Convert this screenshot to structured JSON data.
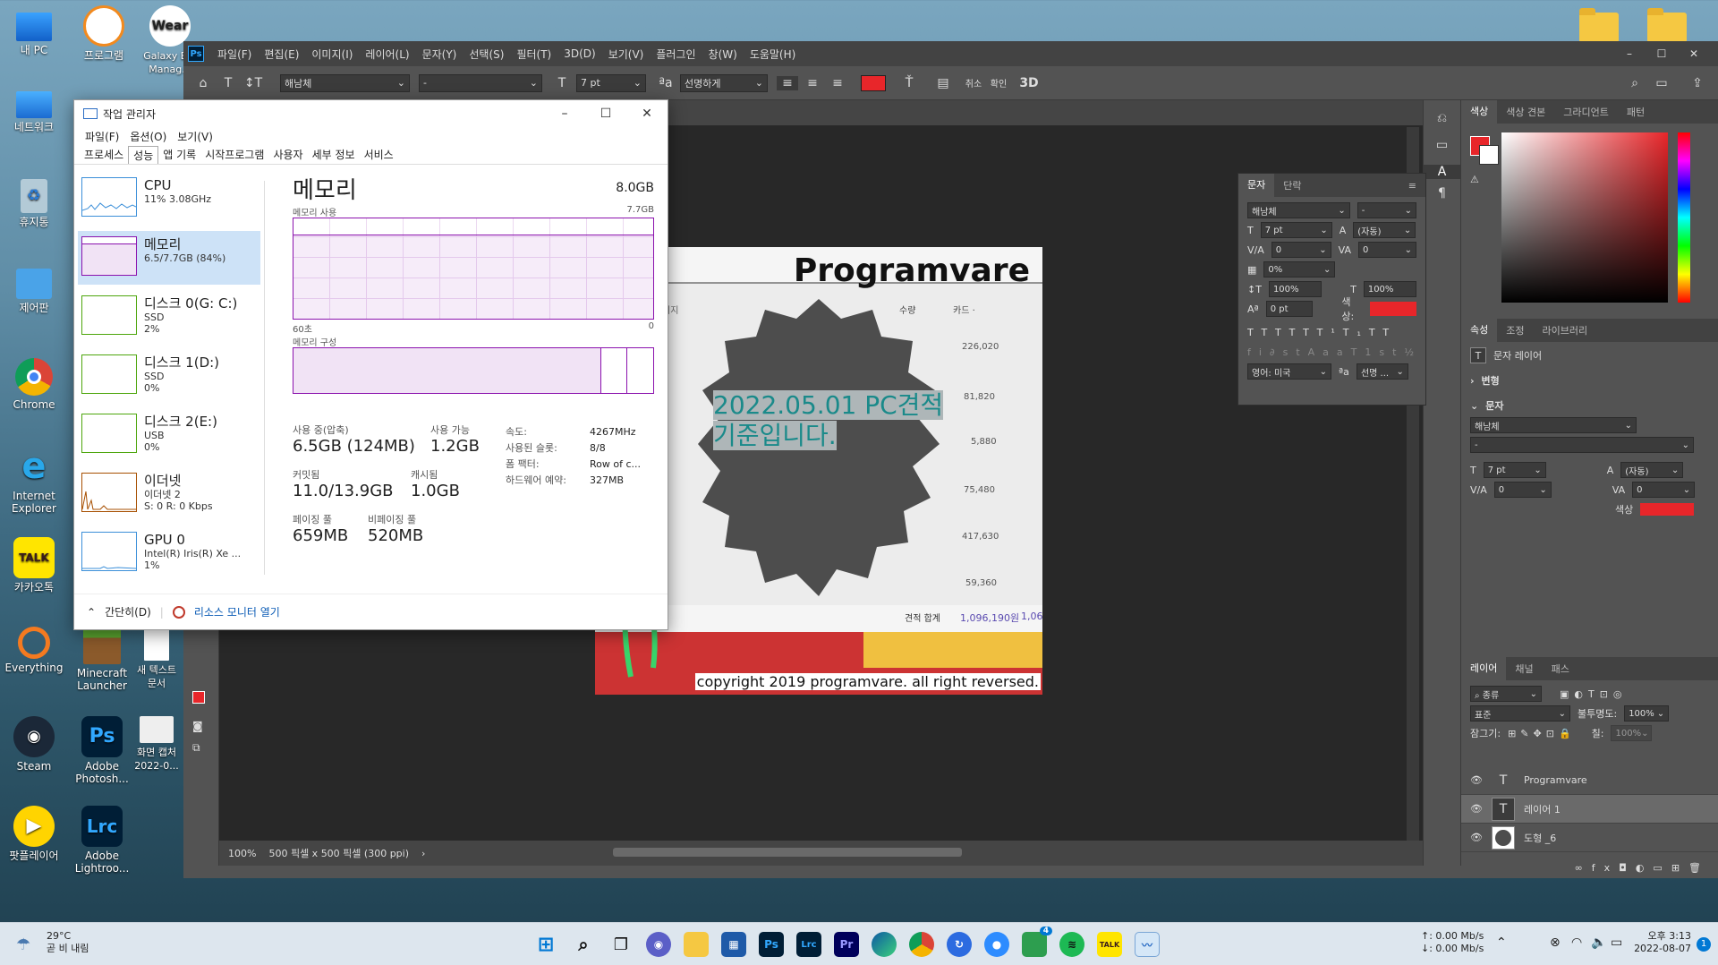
{
  "desktop": {
    "icons": [
      {
        "label": "내 PC",
        "icon": "monitor-icon"
      },
      {
        "label": "프로그램",
        "icon": "app-icon"
      },
      {
        "label": "Wear",
        "icon": "wear-icon"
      },
      {
        "label": "Galaxy B... Manag...",
        "icon": "galaxy-icon"
      },
      {
        "label": "네트워크",
        "icon": "network-icon"
      },
      {
        "label": "휴지통",
        "icon": "recycle-bin-icon"
      },
      {
        "label": "제어판",
        "icon": "control-panel-icon"
      },
      {
        "label": "Chrome",
        "icon": "chrome-icon"
      },
      {
        "label": "Internet Explorer",
        "icon": "ie-icon"
      },
      {
        "label": "카카오톡",
        "icon": "kakaotalk-icon"
      },
      {
        "label": "Everything",
        "icon": "everything-icon"
      },
      {
        "label": "Minecraft Launcher",
        "icon": "minecraft-icon"
      },
      {
        "label": "새 텍스트 문서",
        "icon": "text-doc-icon"
      },
      {
        "label": "Steam",
        "icon": "steam-icon"
      },
      {
        "label": "Adobe Photosh...",
        "icon": "photoshop-icon"
      },
      {
        "label": "화면 캡처 2022-0...",
        "icon": "screenshot-icon"
      },
      {
        "label": "팟플레이어",
        "icon": "potplayer-icon"
      },
      {
        "label": "Adobe Lightroo...",
        "icon": "lightroom-icon"
      }
    ]
  },
  "photoshop": {
    "logo": "Ps",
    "menu": [
      "파일(F)",
      "편집(E)",
      "이미지(I)",
      "레이어(L)",
      "문자(Y)",
      "선택(S)",
      "필터(T)",
      "3D(D)",
      "보기(V)",
      "플러그인",
      "창(W)",
      "도움말(H)"
    ],
    "options": {
      "font_family": "해남체",
      "font_style": "-",
      "font_size": "7 pt",
      "aa_label": "ªa",
      "antialias": "선명하게",
      "threed": "3D",
      "cancel": "취소",
      "commit": "확인",
      "text_color": "#e8262a"
    },
    "canvas": {
      "title": "Programvare",
      "text_line1": "2022.05.01 PC견적",
      "text_line2": "기준입니다.",
      "footer": "copyright 2019 programvare. all right reversed.",
      "bg_numbers": [
        "226,020",
        "81,820",
        "5,880",
        "75,480",
        "417,630",
        "59,360"
      ],
      "bg_total_label": "견적 합계",
      "bg_total": "1,096,190원",
      "bg_total2": "1,06",
      "bg_header_qty": "수량",
      "bg_header_img": "미지",
      "bg_header_price": "카드 ·"
    },
    "status": {
      "zoom": "100%",
      "doc_size": "500 픽셀 x 500 픽셀 (300 ppi)",
      "arrow": "›"
    },
    "char_panel": {
      "tabs": [
        "문자",
        "단락"
      ],
      "font": "해남체",
      "style": "-",
      "size": "7 pt",
      "leading": "(자동)",
      "kerning": "0",
      "tracking": "0",
      "scale_pct": "0%",
      "vscale": "100%",
      "hscale": "100%",
      "baseline": "0 pt",
      "color_label": "색상:",
      "language": "영어: 미국",
      "aa_label": "ªa",
      "aa": "선명 ..."
    },
    "color_panel": {
      "tabs": [
        "색상",
        "색상 견본",
        "그라디언트",
        "패턴"
      ]
    },
    "props_panel": {
      "tabs": [
        "속성",
        "조정",
        "라이브러리"
      ],
      "layer_type": "문자 레이어",
      "transform": "변형",
      "text_section": "문자",
      "font": "해남체",
      "style": "-",
      "size": "7 pt",
      "leading": "(자동)",
      "kerning": "0",
      "tracking": "0",
      "color_label": "색상"
    },
    "layers_panel": {
      "tabs": [
        "레이어",
        "채널",
        "패스"
      ],
      "filter": "종류",
      "blend": "표준",
      "opacity_label": "불투명도:",
      "opacity": "100%",
      "lock_label": "잠그기:",
      "fill_label": "칠:",
      "fill": "100%",
      "layers": [
        {
          "name": "Programvare",
          "kind": "T"
        },
        {
          "name": "레이어 1",
          "kind": "T"
        },
        {
          "name": "도형 _6",
          "kind": "shape"
        }
      ]
    }
  },
  "taskmanager": {
    "title": "작업 관리자",
    "menu": [
      "파일(F)",
      "옵션(O)",
      "보기(V)"
    ],
    "tabs": [
      "프로세스",
      "성능",
      "앱 기록",
      "시작프로그램",
      "사용자",
      "세부 정보",
      "서비스"
    ],
    "side": [
      {
        "name": "CPU",
        "sub1": "11% 3.08GHz",
        "sub2": ""
      },
      {
        "name": "메모리",
        "sub1": "6.5/7.7GB (84%)",
        "sub2": ""
      },
      {
        "name": "디스크 0(G: C:)",
        "sub1": "SSD",
        "sub2": "2%"
      },
      {
        "name": "디스크 1(D:)",
        "sub1": "SSD",
        "sub2": "0%"
      },
      {
        "name": "디스크 2(E:)",
        "sub1": "USB",
        "sub2": "0%"
      },
      {
        "name": "이더넷",
        "sub1": "이더넷 2",
        "sub2": "S: 0 R: 0 Kbps"
      },
      {
        "name": "GPU 0",
        "sub1": "Intel(R) Iris(R) Xe ...",
        "sub2": "1%"
      }
    ],
    "detail": {
      "heading": "메모리",
      "total": "8.0GB",
      "usage_label": "메모리 사용",
      "usage_max": "7.7GB",
      "time_left": "60초",
      "time_right": "0",
      "composition_label": "메모리 구성",
      "in_use_label": "사용 중(압축)",
      "in_use": "6.5GB (124MB)",
      "available_label": "사용 가능",
      "available": "1.2GB",
      "committed_label": "커밋됨",
      "committed": "11.0/13.9GB",
      "cached_label": "캐시됨",
      "cached": "1.0GB",
      "paged_label": "페이징 풀",
      "paged": "659MB",
      "nonpaged_label": "비페이징 풀",
      "nonpaged": "520MB",
      "speed_label": "속도:",
      "speed": "4267MHz",
      "slots_label": "사용된 슬롯:",
      "slots": "8/8",
      "form_label": "폼 팩터:",
      "form": "Row of c...",
      "reserved_label": "하드웨어 예약:",
      "reserved": "327MB"
    },
    "footer": {
      "simple": "간단히(D)",
      "monitor": "리소스 모니터 열기"
    }
  },
  "taskbar": {
    "weather_temp": "29°C",
    "weather_desc": "곧 비 내림",
    "net_up": "↑: 0.00 Mb/s",
    "net_down": "↓: 0.00 Mb/s",
    "time": "오후 3:13",
    "date": "2022-08-07",
    "notif_count": "1",
    "badge": "4",
    "apps": [
      "start",
      "search",
      "taskview",
      "chat",
      "explorer",
      "store",
      "photoshop",
      "lightroom",
      "premiere",
      "edge",
      "chrome",
      "iorbit",
      "zoom",
      "gamebar",
      "spotify",
      "kakaotalk",
      "taskmanager"
    ]
  }
}
